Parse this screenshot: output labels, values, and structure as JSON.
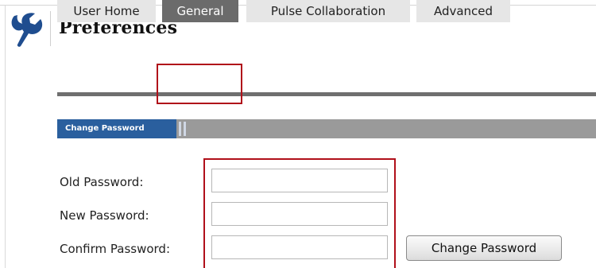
{
  "header": {
    "title": "Preferences",
    "logo_icon": "wrench-icon"
  },
  "tabs": [
    {
      "label": "User Home",
      "active": false
    },
    {
      "label": "General",
      "active": true
    },
    {
      "label": "Pulse Collaboration",
      "active": false
    },
    {
      "label": "Advanced",
      "active": false
    }
  ],
  "section": {
    "label": "Change Password"
  },
  "form": {
    "old_password_label": "Old Password:",
    "new_password_label": "New Password:",
    "confirm_password_label": "Confirm Password:",
    "old_password_value": "",
    "new_password_value": "",
    "confirm_password_value": "",
    "submit_label": "Change Password"
  },
  "colors": {
    "accent_blue": "#2a5f9e",
    "active_tab": "#6b6b6b",
    "highlight_red": "#b0101a"
  }
}
